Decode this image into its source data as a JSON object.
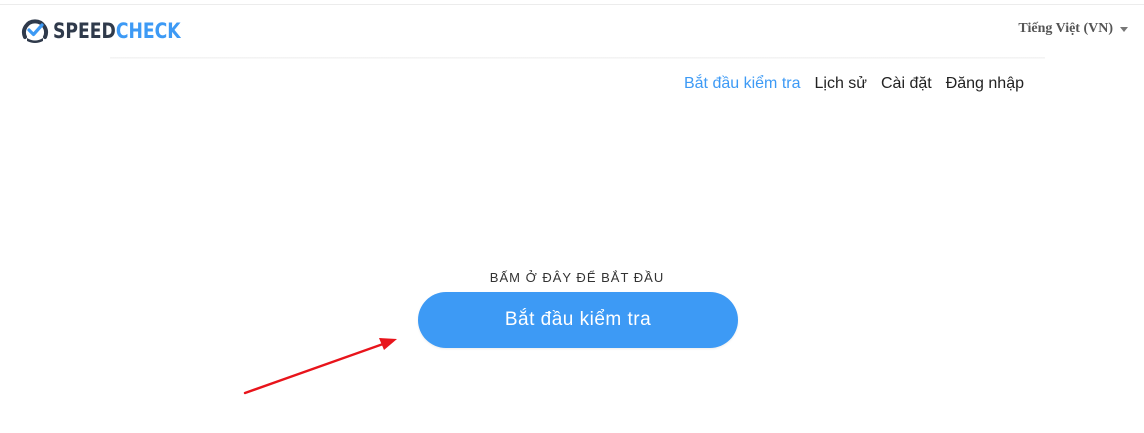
{
  "header": {
    "logo": {
      "part1": "SPEED",
      "part2": "CHECK"
    },
    "language": "Tiếng Việt (VN)"
  },
  "nav": {
    "items": [
      {
        "label": "Bắt đầu kiểm tra",
        "active": true
      },
      {
        "label": "Lịch sử",
        "active": false
      },
      {
        "label": "Cài đặt",
        "active": false
      },
      {
        "label": "Đăng nhập",
        "active": false
      }
    ]
  },
  "main": {
    "hint": "BẤM Ở ĐÂY ĐỂ BẮT ĐẦU",
    "start_button": "Bắt đầu kiểm tra"
  },
  "colors": {
    "accent": "#3d9af5",
    "logo_dark": "#2f3a4b",
    "annotation_arrow": "#e8141b"
  }
}
